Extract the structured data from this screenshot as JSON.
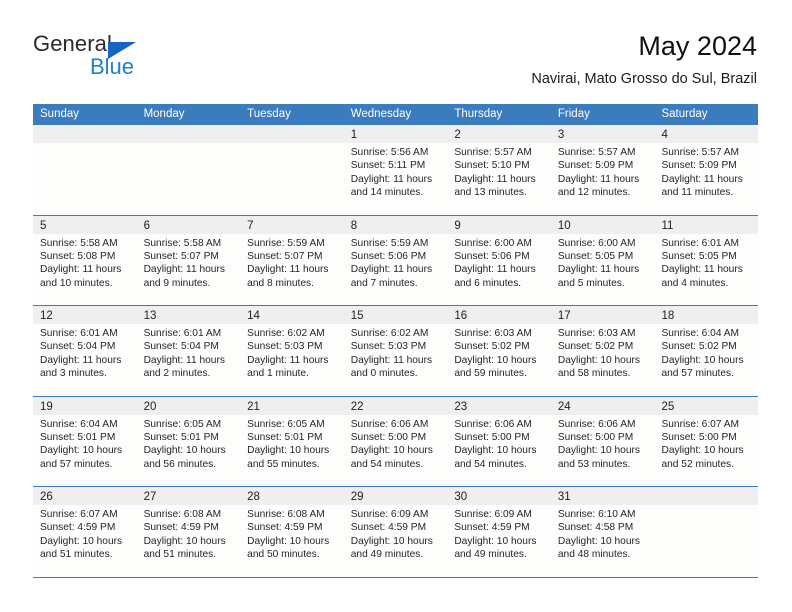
{
  "logo": {
    "word1": "General",
    "word2": "Blue",
    "triangle_color": "#1565c0",
    "blue_color": "#1f7fd0"
  },
  "header": {
    "title": "May 2024",
    "subtitle": "Navirai, Mato Grosso do Sul, Brazil"
  },
  "theme": {
    "header_blue": "#3a7cbd",
    "day_band_gray": "#efefef",
    "cell_bg": "#fdfdfc"
  },
  "weekdays": [
    "Sunday",
    "Monday",
    "Tuesday",
    "Wednesday",
    "Thursday",
    "Friday",
    "Saturday"
  ],
  "weeks": [
    [
      {
        "day": "",
        "empty": true,
        "sunrise": "",
        "sunset": "",
        "daylight1": "",
        "daylight2": ""
      },
      {
        "day": "",
        "empty": true,
        "sunrise": "",
        "sunset": "",
        "daylight1": "",
        "daylight2": ""
      },
      {
        "day": "",
        "empty": true,
        "sunrise": "",
        "sunset": "",
        "daylight1": "",
        "daylight2": ""
      },
      {
        "day": "1",
        "empty": false,
        "sunrise": "Sunrise: 5:56 AM",
        "sunset": "Sunset: 5:11 PM",
        "daylight1": "Daylight: 11 hours",
        "daylight2": "and 14 minutes."
      },
      {
        "day": "2",
        "empty": false,
        "sunrise": "Sunrise: 5:57 AM",
        "sunset": "Sunset: 5:10 PM",
        "daylight1": "Daylight: 11 hours",
        "daylight2": "and 13 minutes."
      },
      {
        "day": "3",
        "empty": false,
        "sunrise": "Sunrise: 5:57 AM",
        "sunset": "Sunset: 5:09 PM",
        "daylight1": "Daylight: 11 hours",
        "daylight2": "and 12 minutes."
      },
      {
        "day": "4",
        "empty": false,
        "sunrise": "Sunrise: 5:57 AM",
        "sunset": "Sunset: 5:09 PM",
        "daylight1": "Daylight: 11 hours",
        "daylight2": "and 11 minutes."
      }
    ],
    [
      {
        "day": "5",
        "empty": false,
        "sunrise": "Sunrise: 5:58 AM",
        "sunset": "Sunset: 5:08 PM",
        "daylight1": "Daylight: 11 hours",
        "daylight2": "and 10 minutes."
      },
      {
        "day": "6",
        "empty": false,
        "sunrise": "Sunrise: 5:58 AM",
        "sunset": "Sunset: 5:07 PM",
        "daylight1": "Daylight: 11 hours",
        "daylight2": "and 9 minutes."
      },
      {
        "day": "7",
        "empty": false,
        "sunrise": "Sunrise: 5:59 AM",
        "sunset": "Sunset: 5:07 PM",
        "daylight1": "Daylight: 11 hours",
        "daylight2": "and 8 minutes."
      },
      {
        "day": "8",
        "empty": false,
        "sunrise": "Sunrise: 5:59 AM",
        "sunset": "Sunset: 5:06 PM",
        "daylight1": "Daylight: 11 hours",
        "daylight2": "and 7 minutes."
      },
      {
        "day": "9",
        "empty": false,
        "sunrise": "Sunrise: 6:00 AM",
        "sunset": "Sunset: 5:06 PM",
        "daylight1": "Daylight: 11 hours",
        "daylight2": "and 6 minutes."
      },
      {
        "day": "10",
        "empty": false,
        "sunrise": "Sunrise: 6:00 AM",
        "sunset": "Sunset: 5:05 PM",
        "daylight1": "Daylight: 11 hours",
        "daylight2": "and 5 minutes."
      },
      {
        "day": "11",
        "empty": false,
        "sunrise": "Sunrise: 6:01 AM",
        "sunset": "Sunset: 5:05 PM",
        "daylight1": "Daylight: 11 hours",
        "daylight2": "and 4 minutes."
      }
    ],
    [
      {
        "day": "12",
        "empty": false,
        "sunrise": "Sunrise: 6:01 AM",
        "sunset": "Sunset: 5:04 PM",
        "daylight1": "Daylight: 11 hours",
        "daylight2": "and 3 minutes."
      },
      {
        "day": "13",
        "empty": false,
        "sunrise": "Sunrise: 6:01 AM",
        "sunset": "Sunset: 5:04 PM",
        "daylight1": "Daylight: 11 hours",
        "daylight2": "and 2 minutes."
      },
      {
        "day": "14",
        "empty": false,
        "sunrise": "Sunrise: 6:02 AM",
        "sunset": "Sunset: 5:03 PM",
        "daylight1": "Daylight: 11 hours",
        "daylight2": "and 1 minute."
      },
      {
        "day": "15",
        "empty": false,
        "sunrise": "Sunrise: 6:02 AM",
        "sunset": "Sunset: 5:03 PM",
        "daylight1": "Daylight: 11 hours",
        "daylight2": "and 0 minutes."
      },
      {
        "day": "16",
        "empty": false,
        "sunrise": "Sunrise: 6:03 AM",
        "sunset": "Sunset: 5:02 PM",
        "daylight1": "Daylight: 10 hours",
        "daylight2": "and 59 minutes."
      },
      {
        "day": "17",
        "empty": false,
        "sunrise": "Sunrise: 6:03 AM",
        "sunset": "Sunset: 5:02 PM",
        "daylight1": "Daylight: 10 hours",
        "daylight2": "and 58 minutes."
      },
      {
        "day": "18",
        "empty": false,
        "sunrise": "Sunrise: 6:04 AM",
        "sunset": "Sunset: 5:02 PM",
        "daylight1": "Daylight: 10 hours",
        "daylight2": "and 57 minutes."
      }
    ],
    [
      {
        "day": "19",
        "empty": false,
        "sunrise": "Sunrise: 6:04 AM",
        "sunset": "Sunset: 5:01 PM",
        "daylight1": "Daylight: 10 hours",
        "daylight2": "and 57 minutes."
      },
      {
        "day": "20",
        "empty": false,
        "sunrise": "Sunrise: 6:05 AM",
        "sunset": "Sunset: 5:01 PM",
        "daylight1": "Daylight: 10 hours",
        "daylight2": "and 56 minutes."
      },
      {
        "day": "21",
        "empty": false,
        "sunrise": "Sunrise: 6:05 AM",
        "sunset": "Sunset: 5:01 PM",
        "daylight1": "Daylight: 10 hours",
        "daylight2": "and 55 minutes."
      },
      {
        "day": "22",
        "empty": false,
        "sunrise": "Sunrise: 6:06 AM",
        "sunset": "Sunset: 5:00 PM",
        "daylight1": "Daylight: 10 hours",
        "daylight2": "and 54 minutes."
      },
      {
        "day": "23",
        "empty": false,
        "sunrise": "Sunrise: 6:06 AM",
        "sunset": "Sunset: 5:00 PM",
        "daylight1": "Daylight: 10 hours",
        "daylight2": "and 54 minutes."
      },
      {
        "day": "24",
        "empty": false,
        "sunrise": "Sunrise: 6:06 AM",
        "sunset": "Sunset: 5:00 PM",
        "daylight1": "Daylight: 10 hours",
        "daylight2": "and 53 minutes."
      },
      {
        "day": "25",
        "empty": false,
        "sunrise": "Sunrise: 6:07 AM",
        "sunset": "Sunset: 5:00 PM",
        "daylight1": "Daylight: 10 hours",
        "daylight2": "and 52 minutes."
      }
    ],
    [
      {
        "day": "26",
        "empty": false,
        "sunrise": "Sunrise: 6:07 AM",
        "sunset": "Sunset: 4:59 PM",
        "daylight1": "Daylight: 10 hours",
        "daylight2": "and 51 minutes."
      },
      {
        "day": "27",
        "empty": false,
        "sunrise": "Sunrise: 6:08 AM",
        "sunset": "Sunset: 4:59 PM",
        "daylight1": "Daylight: 10 hours",
        "daylight2": "and 51 minutes."
      },
      {
        "day": "28",
        "empty": false,
        "sunrise": "Sunrise: 6:08 AM",
        "sunset": "Sunset: 4:59 PM",
        "daylight1": "Daylight: 10 hours",
        "daylight2": "and 50 minutes."
      },
      {
        "day": "29",
        "empty": false,
        "sunrise": "Sunrise: 6:09 AM",
        "sunset": "Sunset: 4:59 PM",
        "daylight1": "Daylight: 10 hours",
        "daylight2": "and 49 minutes."
      },
      {
        "day": "30",
        "empty": false,
        "sunrise": "Sunrise: 6:09 AM",
        "sunset": "Sunset: 4:59 PM",
        "daylight1": "Daylight: 10 hours",
        "daylight2": "and 49 minutes."
      },
      {
        "day": "31",
        "empty": false,
        "sunrise": "Sunrise: 6:10 AM",
        "sunset": "Sunset: 4:58 PM",
        "daylight1": "Daylight: 10 hours",
        "daylight2": "and 48 minutes."
      },
      {
        "day": "",
        "empty": true,
        "sunrise": "",
        "sunset": "",
        "daylight1": "",
        "daylight2": ""
      }
    ]
  ]
}
